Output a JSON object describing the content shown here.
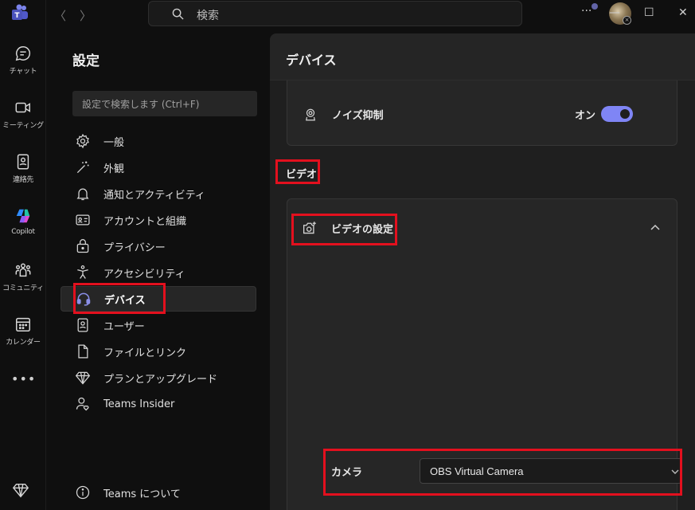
{
  "topbar": {
    "search_placeholder": "検索",
    "back_arrow": "〈",
    "forward_arrow": "〉",
    "more": "···",
    "minimize": "—",
    "maximize": "☐",
    "close": "✕"
  },
  "rail": {
    "items": [
      {
        "label": "チャット",
        "icon": "chat-icon"
      },
      {
        "label": "ミーティング",
        "icon": "video-icon"
      },
      {
        "label": "連絡先",
        "icon": "contacts-icon"
      },
      {
        "label": "Copilot",
        "icon": "copilot-icon"
      },
      {
        "label": "コミュニティ",
        "icon": "community-icon"
      },
      {
        "label": "カレンダー",
        "icon": "calendar-icon"
      }
    ],
    "more": "•••"
  },
  "settings": {
    "title": "設定",
    "search_placeholder": "設定で検索します (Ctrl+F)",
    "items": [
      {
        "label": "一般",
        "icon": "gear-icon"
      },
      {
        "label": "外観",
        "icon": "wand-icon"
      },
      {
        "label": "通知とアクティビティ",
        "icon": "bell-icon"
      },
      {
        "label": "アカウントと組織",
        "icon": "id-card-icon"
      },
      {
        "label": "プライバシー",
        "icon": "lock-icon"
      },
      {
        "label": "アクセシビリティ",
        "icon": "accessibility-icon"
      },
      {
        "label": "デバイス",
        "icon": "headset-icon",
        "active": true
      },
      {
        "label": "ユーザー",
        "icon": "user-icon"
      },
      {
        "label": "ファイルとリンク",
        "icon": "file-icon"
      },
      {
        "label": "プランとアップグレード",
        "icon": "diamond-icon"
      },
      {
        "label": "Teams Insider",
        "icon": "insider-icon"
      }
    ],
    "about": "Teams について"
  },
  "panel": {
    "title": "デバイス",
    "noise": {
      "label": "ノイズ抑制",
      "state": "オン"
    },
    "video_section": "ビデオ",
    "video_settings": "ビデオの設定",
    "camera_label": "カメラ",
    "camera_value": "OBS Virtual Camera"
  },
  "colors": {
    "accent": "#7f85f5",
    "highlight": "#e3101e",
    "brand": "#6264a7"
  }
}
